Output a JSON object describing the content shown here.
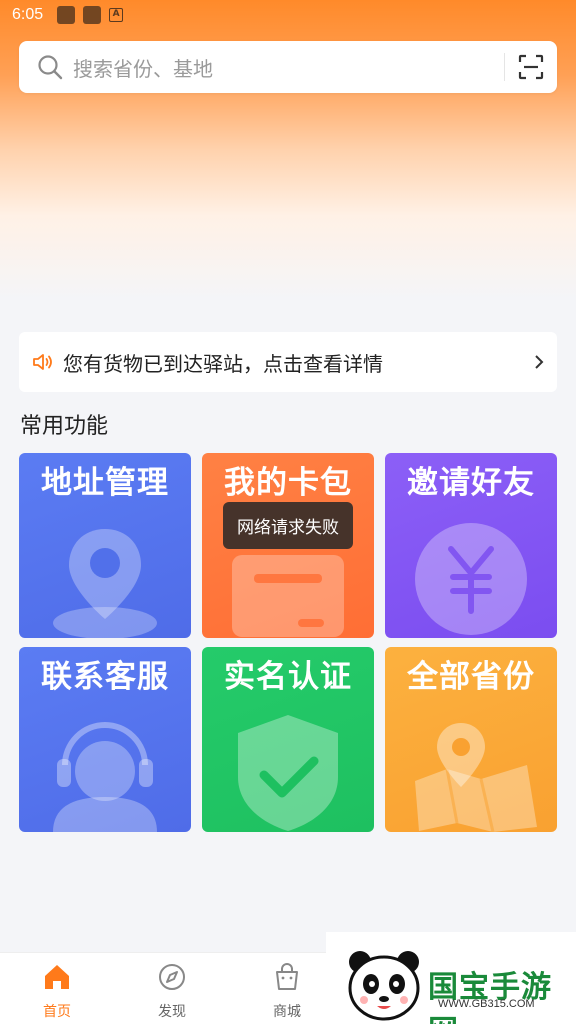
{
  "status_bar": {
    "time": "6:05"
  },
  "search": {
    "placeholder": "搜索省份、基地"
  },
  "notice": {
    "text": "您有货物已到达驿站，点击查看详情"
  },
  "section": {
    "title": "常用功能"
  },
  "functions": [
    {
      "label": "地址管理",
      "color": "#5a78f0"
    },
    {
      "label": "我的卡包",
      "color": "#ff7a3d"
    },
    {
      "label": "邀请好友",
      "color": "#8a5cf5"
    },
    {
      "label": "联系客服",
      "color": "#5a78f0"
    },
    {
      "label": "实名认证",
      "color": "#22c765"
    },
    {
      "label": "全部省份",
      "color": "#fba739"
    }
  ],
  "toast": {
    "text": "网络请求失败"
  },
  "tabbar": {
    "items": [
      {
        "label": "首页",
        "icon": "home-icon",
        "active": true
      },
      {
        "label": "发现",
        "icon": "compass-icon",
        "active": false
      },
      {
        "label": "商城",
        "icon": "shopping-bag-icon",
        "active": false
      }
    ]
  },
  "watermark": {
    "brand": "国宝手游网",
    "url": "WWW.GB315.COM"
  },
  "colors": {
    "accent": "#ff7a1a",
    "header": "#ff8a2a"
  }
}
